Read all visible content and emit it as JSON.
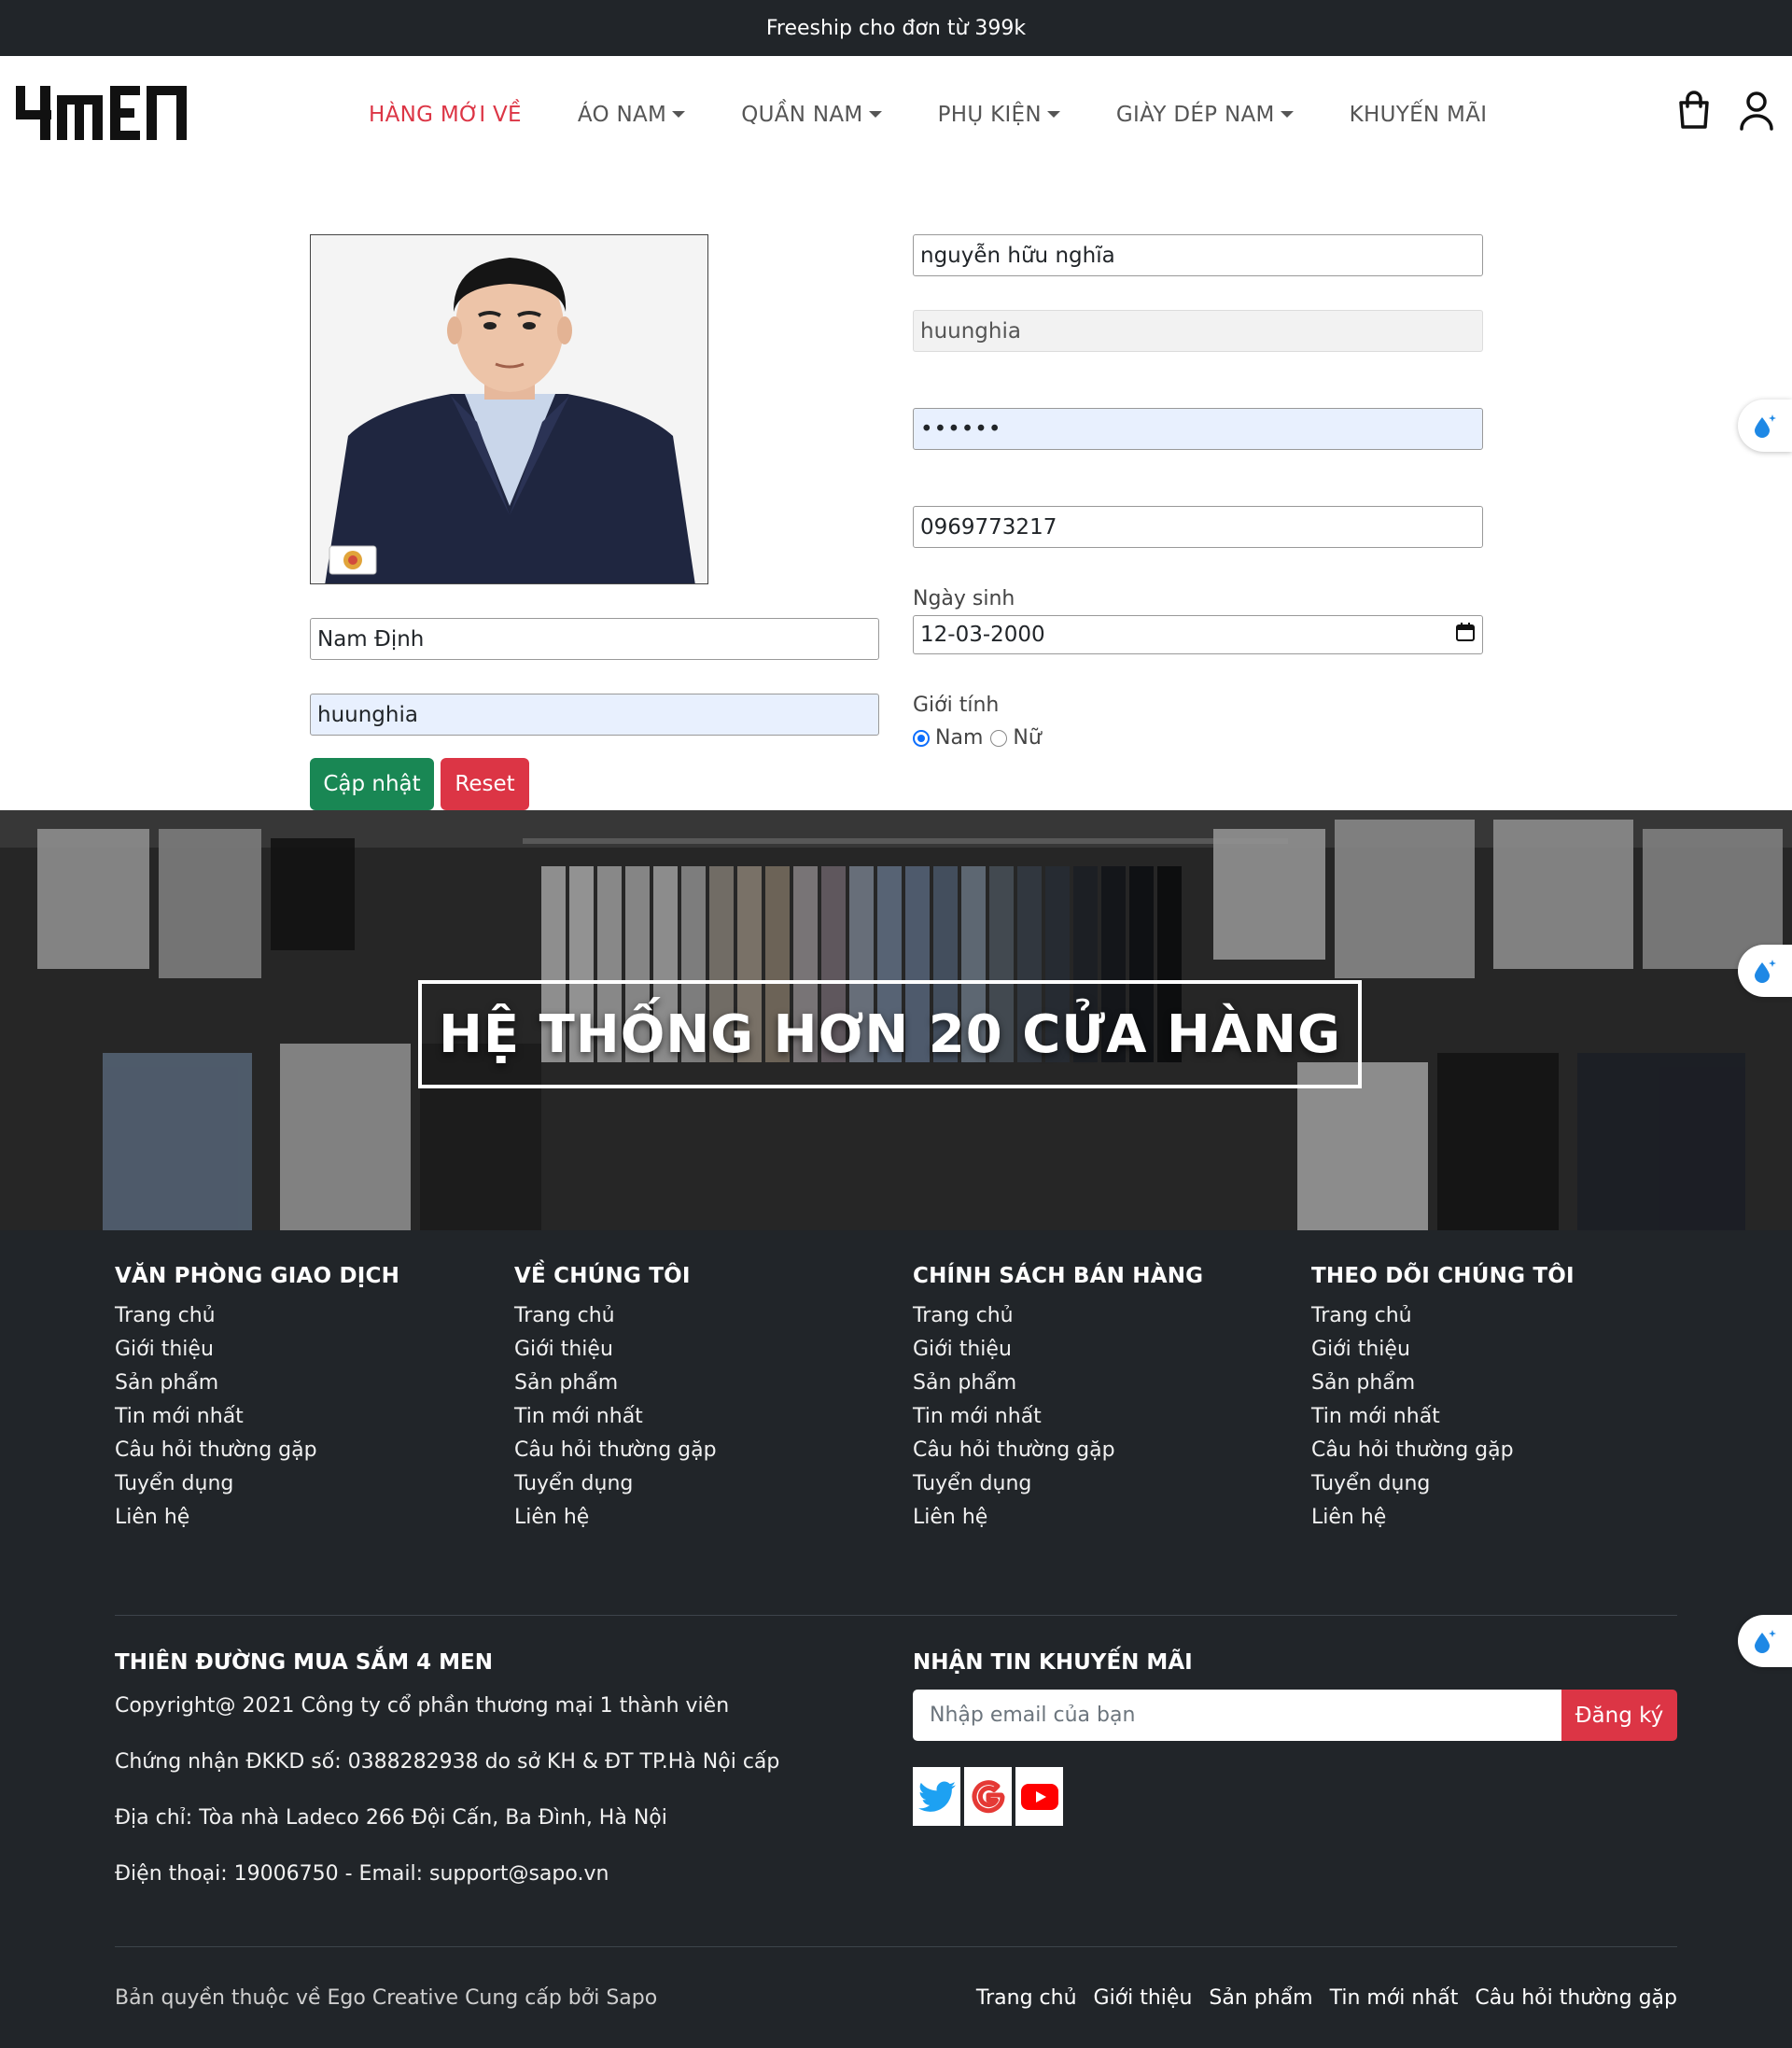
{
  "announcement": "Freeship cho đơn từ 399k",
  "brand": {
    "logo_text": "4MEN"
  },
  "nav": {
    "items": [
      {
        "label": "HÀNG MỚI VỀ",
        "active": true,
        "dropdown": false
      },
      {
        "label": "ÁO NAM",
        "active": false,
        "dropdown": true
      },
      {
        "label": "QUẦN NAM",
        "active": false,
        "dropdown": true
      },
      {
        "label": "PHỤ KIỆN",
        "active": false,
        "dropdown": true
      },
      {
        "label": "GIÀY DÉP NAM",
        "active": false,
        "dropdown": true
      },
      {
        "label": "KHUYẾN MÃI",
        "active": false,
        "dropdown": false
      }
    ],
    "icons": [
      "shopping-bag-icon",
      "user-icon"
    ]
  },
  "profile_form": {
    "full_name": "nguyễn hữu nghĩa",
    "username": "huunghia",
    "password_mask": "••••••",
    "phone": "0969773217",
    "birthdate_label": "Ngày sinh",
    "birthdate": "12-03-2000",
    "gender_label": "Giới tính",
    "gender_options": [
      "Nam",
      "Nữ"
    ],
    "gender_selected": "Nam",
    "address": "Nam Định",
    "account": "huunghia",
    "update_button": "Cập nhật",
    "reset_button": "Reset"
  },
  "banner": {
    "headline": "HỆ THỐNG HƠN 20 CỬA HÀNG"
  },
  "footer": {
    "columns": [
      {
        "title": "VĂN PHÒNG GIAO DỊCH",
        "links": [
          "Trang chủ",
          "Giới thiệu",
          "Sản phẩm",
          "Tin mới nhất",
          "Câu hỏi thường gặp",
          "Tuyển dụng",
          "Liên hệ"
        ]
      },
      {
        "title": "VỀ CHÚNG TÔI",
        "links": [
          "Trang chủ",
          "Giới thiệu",
          "Sản phẩm",
          "Tin mới nhất",
          "Câu hỏi thường gặp",
          "Tuyển dụng",
          "Liên hệ"
        ]
      },
      {
        "title": "CHÍNH SÁCH BÁN HÀNG",
        "links": [
          "Trang chủ",
          "Giới thiệu",
          "Sản phẩm",
          "Tin mới nhất",
          "Câu hỏi thường gặp",
          "Tuyển dụng",
          "Liên hệ"
        ]
      },
      {
        "title": "THEO DÕI CHÚNG TÔI",
        "links": [
          "Trang chủ",
          "Giới thiệu",
          "Sản phẩm",
          "Tin mới nhất",
          "Câu hỏi thường gặp",
          "Tuyển dụng",
          "Liên hệ"
        ]
      }
    ],
    "company_title": "THIÊN ĐƯỜNG MUA SẮM 4 MEN",
    "company_lines": [
      "Copyright@ 2021 Công ty cổ phần thương mại 1 thành viên",
      "Chứng nhận ĐKKD số: 0388282938 do sở KH & ĐT TP.Hà Nội cấp",
      "Địa chỉ: Tòa nhà Ladeco 266 Đội Cấn, Ba Đình, Hà Nội",
      "Điện thoại: 19006750 - Email: support@sapo.vn"
    ],
    "newsletter_title": "NHẬN TIN KHUYẾN MÃI",
    "newsletter_placeholder": "Nhập email của bạn",
    "newsletter_button": "Đăng ký",
    "social_icons": [
      "twitter-icon",
      "google-icon",
      "youtube-icon"
    ],
    "copyright": "Bản quyền thuộc về Ego Creative Cung cấp bởi Sapo",
    "bottom_links": [
      "Trang chủ",
      "Giới thiệu",
      "Sản phẩm",
      "Tin mới nhất",
      "Câu hỏi thường gặp"
    ]
  },
  "colors": {
    "dark": "#212529",
    "accent_red": "#dc3545",
    "success_green": "#198754",
    "autofill_blue": "#e8f0fe",
    "radio_blue": "#0d6efd",
    "twitter": "#1da1f2",
    "youtube": "#ff0000"
  }
}
